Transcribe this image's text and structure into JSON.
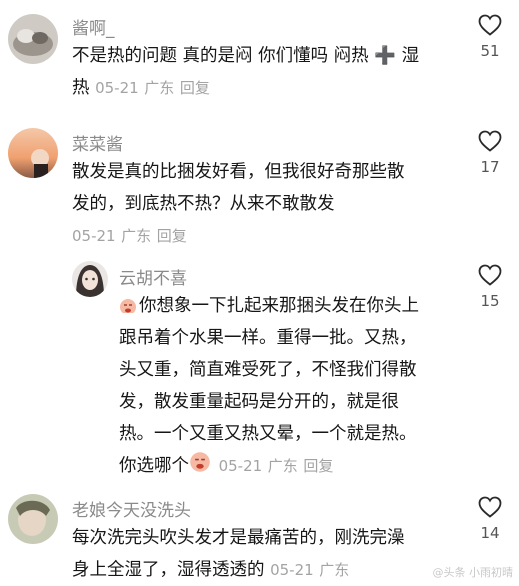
{
  "comments": [
    {
      "username": "酱啊_",
      "text_lines": [
        "不是热的问题 真的是闷 你们懂吗 闷热 ➕ 湿",
        "热"
      ],
      "date": "05-21",
      "location": "广东",
      "reply": "回复",
      "likes": "51"
    },
    {
      "username": "菜菜酱",
      "text_lines": [
        "散发是真的比捆发好看，但我很好奇那些散",
        "发的，到底热不热？从来不敢散发"
      ],
      "date": "05-21",
      "location": "广东",
      "reply": "回复",
      "likes": "17"
    },
    {
      "username": "云胡不喜",
      "text_lines": [
        "你想象一下扎起来那捆头发在你头上",
        "跟吊着个水果一样。重得一批。又热，",
        "头又重，简直难受死了，不怪我们得散",
        "发，散发重量起码是分开的，就是很",
        "热。一个又重又热又晕，一个就是热。",
        "你选哪个"
      ],
      "date": "05-21",
      "location": "广东",
      "reply": "回复",
      "likes": "15"
    },
    {
      "username": "老娘今天没洗头",
      "text_lines": [
        "每次洗完头吹头发才是最痛苦的，刚洗完澡",
        "身上全湿了，湿得透透的"
      ],
      "date": "05-21",
      "location": "广东",
      "likes": "14"
    }
  ],
  "watermark": "@头条 小雨初晴"
}
